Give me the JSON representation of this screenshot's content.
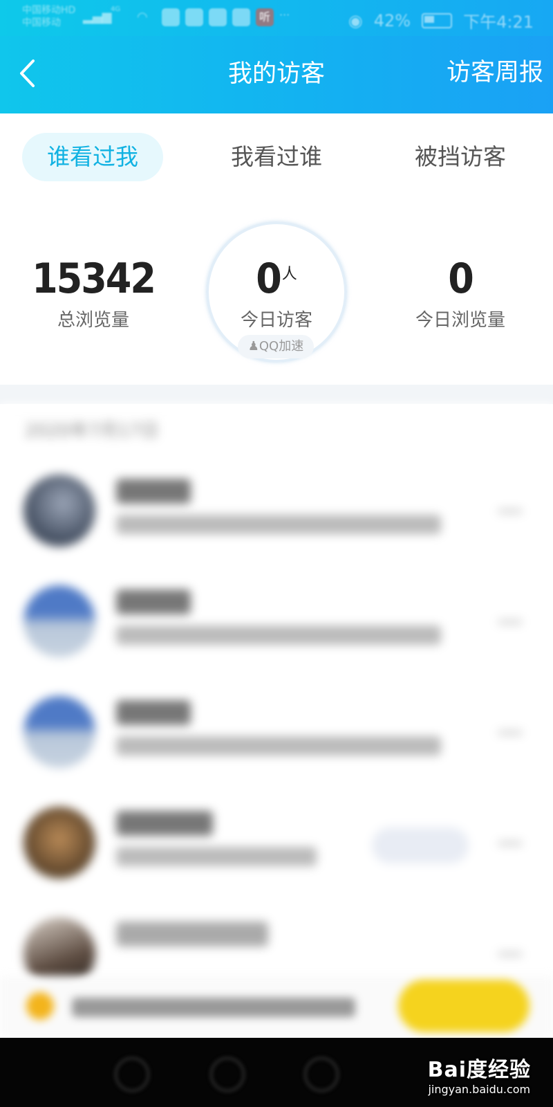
{
  "status_bar": {
    "carrier_top": "中国移动HD",
    "carrier": "中国移动",
    "network": "4G",
    "app_icons": [
      "video-app-icon",
      "baidu-app-icon",
      "map-pin-app-icon",
      "browser-app-icon",
      "listen-app-icon"
    ],
    "listen_label": "听",
    "more": "···",
    "battery": "42%",
    "time": "下午4:21"
  },
  "header": {
    "back_icon": "chevron-left-icon",
    "title": "我的访客",
    "right_action": "访客周报"
  },
  "tabs": [
    {
      "label": "谁看过我",
      "active": true
    },
    {
      "label": "我看过谁",
      "active": false
    },
    {
      "label": "被挡访客",
      "active": false
    }
  ],
  "stats": {
    "total_views": {
      "value": "15342",
      "label": "总浏览量"
    },
    "today_visitors": {
      "value": "0",
      "unit": "人",
      "label": "今日访客"
    },
    "today_views": {
      "value": "0",
      "label": "今日浏览量"
    },
    "badge": "QQ加速"
  },
  "visitors": {
    "date": "2020年7月17日"
  },
  "colors": {
    "header_start": "#10c6ec",
    "header_end": "#1aa1f5",
    "active_tab_text": "#11b2e2",
    "active_tab_bg": "#e6f8fd",
    "cta_yellow": "#f5d31e"
  },
  "watermark": {
    "brand": "Bai度经验",
    "url": "jingyan.baidu.com"
  }
}
